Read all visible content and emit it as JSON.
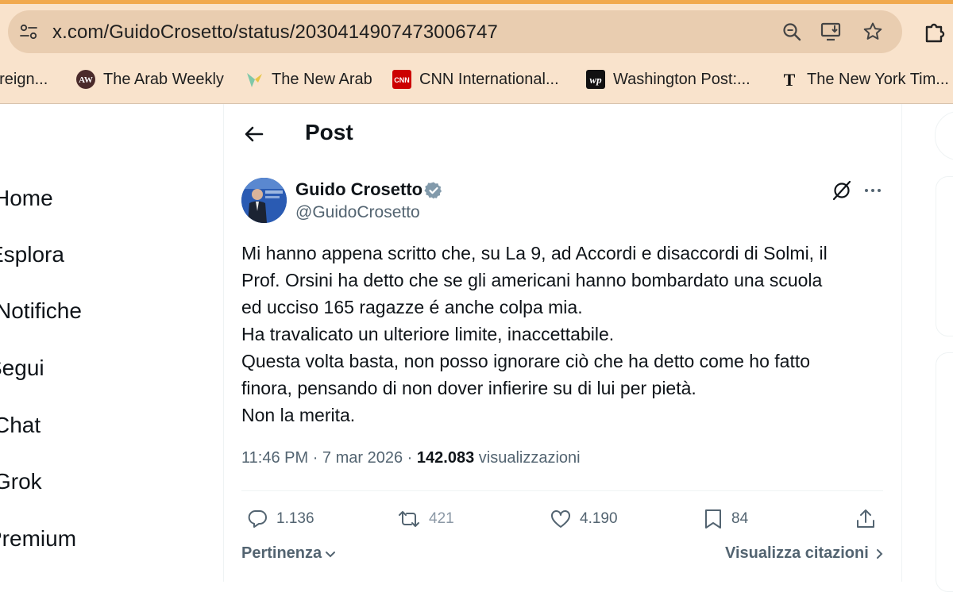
{
  "browser": {
    "url": "x.com/GuidoCrosetto/status/2030414907473006747",
    "bookmarks": [
      {
        "label": "oreign...",
        "icon": "globe-icon"
      },
      {
        "label": "The Arab Weekly",
        "icon": "aw-logo-icon"
      },
      {
        "label": "The New Arab",
        "icon": "new-arab-logo-icon"
      },
      {
        "label": "CNN International...",
        "icon": "cnn-logo-icon"
      },
      {
        "label": "Washington Post:...",
        "icon": "wp-logo-icon"
      },
      {
        "label": "The New York Tim...",
        "icon": "nyt-logo-icon"
      }
    ],
    "cnn_badge": "CNN",
    "wp_badge": "wp",
    "nyt_badge": "T",
    "aw_badge": "AW"
  },
  "nav": {
    "items": [
      "Home",
      "Esplora",
      "Notifiche",
      "Segui",
      "Chat",
      "Grok",
      "Premium"
    ]
  },
  "header": {
    "title": "Post"
  },
  "tweet": {
    "author_name": "Guido Crosetto",
    "handle": "@GuidoCrosetto",
    "lines": [
      "Mi hanno appena scritto che, su La 9, ad Accordi e disaccordi di Solmi, il",
      "Prof. Orsini ha detto che se gli americani hanno bombardato una scuola",
      "ed ucciso 165 ragazze é anche colpa mia.",
      "Ha travalicato un ulteriore limite, inaccettabile.",
      "Questa volta basta, non posso ignorare ciò che ha detto come ho fatto",
      "finora, pensando di non dover infierire su di lui per pietà.",
      "Non la merita."
    ],
    "time": "11:46 PM",
    "separator": "·",
    "date": "7 mar 2026",
    "views_count": "142.083",
    "views_label": "visualizzazioni",
    "replies": "1.136",
    "reposts": "421",
    "likes": "4.190",
    "bookmarks": "84"
  },
  "footer": {
    "sort_label": "Pertinenza",
    "quotes_label": "Visualizza citazioni"
  },
  "colors": {
    "accent_bar": "#f1a94e",
    "chrome_bg": "#f9e3cc",
    "secondary_text": "#536471",
    "verified": "#829aab"
  }
}
